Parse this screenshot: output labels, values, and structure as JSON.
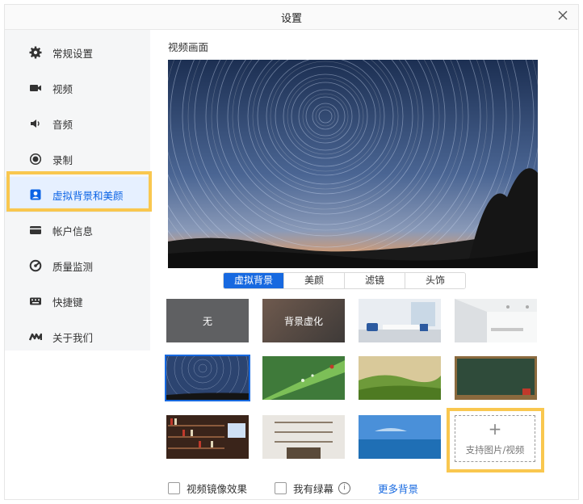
{
  "window": {
    "title": "设置"
  },
  "sidebar": {
    "items": [
      {
        "label": "常规设置",
        "icon": "gear-icon"
      },
      {
        "label": "视频",
        "icon": "video-camera-icon"
      },
      {
        "label": "音频",
        "icon": "speaker-icon"
      },
      {
        "label": "录制",
        "icon": "record-icon"
      },
      {
        "label": "虚拟背景和美颜",
        "icon": "user-portrait-icon",
        "active": true
      },
      {
        "label": "帐户信息",
        "icon": "card-icon"
      },
      {
        "label": "质量监测",
        "icon": "monitor-gauge-icon"
      },
      {
        "label": "快捷键",
        "icon": "keyboard-icon"
      },
      {
        "label": "关于我们",
        "icon": "logo-icon"
      }
    ]
  },
  "main": {
    "section_title": "视频画面",
    "tabs": [
      {
        "label": "虚拟背景",
        "active": true
      },
      {
        "label": "美颜"
      },
      {
        "label": "滤镜"
      },
      {
        "label": "头饰"
      }
    ],
    "backgrounds": [
      {
        "label": "无",
        "kind": "none"
      },
      {
        "label": "背景虚化",
        "kind": "blur"
      },
      {
        "label": "",
        "kind": "office-room"
      },
      {
        "label": "",
        "kind": "white-room"
      },
      {
        "label": "",
        "kind": "star-trails",
        "selected": true
      },
      {
        "label": "",
        "kind": "leaf-ladybug"
      },
      {
        "label": "",
        "kind": "hills"
      },
      {
        "label": "",
        "kind": "chalkboard"
      },
      {
        "label": "",
        "kind": "bookshelf"
      },
      {
        "label": "",
        "kind": "study"
      },
      {
        "label": "",
        "kind": "sea"
      }
    ],
    "upload": {
      "plus": "+",
      "label": "支持图片/视频"
    },
    "options": {
      "mirror_label": "视频镜像效果",
      "greenscreen_label": "我有绿幕",
      "more_label": "更多背景"
    }
  },
  "colors": {
    "accent": "#1769e0",
    "highlight": "#f9c74f",
    "sidebar_bg": "#f5f6f7"
  }
}
